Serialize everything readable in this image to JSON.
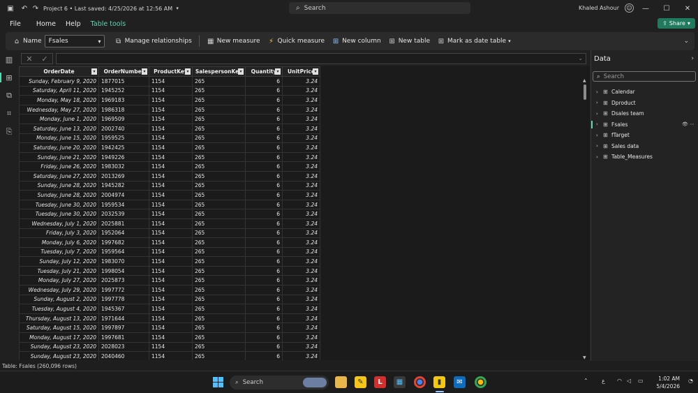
{
  "titlebar": {
    "title": "Project 6 • Last saved: 4/25/2026 at 12:56 AM",
    "search_placeholder": "Search",
    "user_name": "Khaled Ashour"
  },
  "menu": {
    "file": "File",
    "home": "Home",
    "help": "Help",
    "table_tools": "Table tools",
    "share": "Share"
  },
  "ribbon": {
    "name_label": "Name",
    "name_value": "Fsales",
    "manage_relationships": "Manage relationships",
    "new_measure": "New measure",
    "quick_measure": "Quick measure",
    "new_column": "New column",
    "new_table": "New table",
    "mark_as_date_table": "Mark as date table"
  },
  "table": {
    "headers": [
      "OrderDate",
      "OrderNumber",
      "ProductKey",
      "SalespersonKey",
      "Quantity",
      "UnitPrice"
    ],
    "rows": [
      [
        "Sunday, February 9, 2020",
        "1877015",
        "1154",
        "265",
        "6",
        "3.24"
      ],
      [
        "Saturday, April 11, 2020",
        "1945252",
        "1154",
        "265",
        "6",
        "3.24"
      ],
      [
        "Monday, May 18, 2020",
        "1969183",
        "1154",
        "265",
        "6",
        "3.24"
      ],
      [
        "Wednesday, May 27, 2020",
        "1986318",
        "1154",
        "265",
        "6",
        "3.24"
      ],
      [
        "Monday, June 1, 2020",
        "1969509",
        "1154",
        "265",
        "6",
        "3.24"
      ],
      [
        "Saturday, June 13, 2020",
        "2002740",
        "1154",
        "265",
        "6",
        "3.24"
      ],
      [
        "Monday, June 15, 2020",
        "1959525",
        "1154",
        "265",
        "6",
        "3.24"
      ],
      [
        "Saturday, June 20, 2020",
        "1942425",
        "1154",
        "265",
        "6",
        "3.24"
      ],
      [
        "Sunday, June 21, 2020",
        "1949226",
        "1154",
        "265",
        "6",
        "3.24"
      ],
      [
        "Friday, June 26, 2020",
        "1983032",
        "1154",
        "265",
        "6",
        "3.24"
      ],
      [
        "Saturday, June 27, 2020",
        "2013269",
        "1154",
        "265",
        "6",
        "3.24"
      ],
      [
        "Sunday, June 28, 2020",
        "1945282",
        "1154",
        "265",
        "6",
        "3.24"
      ],
      [
        "Sunday, June 28, 2020",
        "2004974",
        "1154",
        "265",
        "6",
        "3.24"
      ],
      [
        "Tuesday, June 30, 2020",
        "1959534",
        "1154",
        "265",
        "6",
        "3.24"
      ],
      [
        "Tuesday, June 30, 2020",
        "2032539",
        "1154",
        "265",
        "6",
        "3.24"
      ],
      [
        "Wednesday, July 1, 2020",
        "2025881",
        "1154",
        "265",
        "6",
        "3.24"
      ],
      [
        "Friday, July 3, 2020",
        "1952064",
        "1154",
        "265",
        "6",
        "3.24"
      ],
      [
        "Monday, July 6, 2020",
        "1997682",
        "1154",
        "265",
        "6",
        "3.24"
      ],
      [
        "Tuesday, July 7, 2020",
        "1959564",
        "1154",
        "265",
        "6",
        "3.24"
      ],
      [
        "Sunday, July 12, 2020",
        "1983070",
        "1154",
        "265",
        "6",
        "3.24"
      ],
      [
        "Tuesday, July 21, 2020",
        "1998054",
        "1154",
        "265",
        "6",
        "3.24"
      ],
      [
        "Monday, July 27, 2020",
        "2025873",
        "1154",
        "265",
        "6",
        "3.24"
      ],
      [
        "Wednesday, July 29, 2020",
        "1997772",
        "1154",
        "265",
        "6",
        "3.24"
      ],
      [
        "Sunday, August 2, 2020",
        "1997778",
        "1154",
        "265",
        "6",
        "3.24"
      ],
      [
        "Tuesday, August 4, 2020",
        "1945367",
        "1154",
        "265",
        "6",
        "3.24"
      ],
      [
        "Thursday, August 13, 2020",
        "1971644",
        "1154",
        "265",
        "6",
        "3.24"
      ],
      [
        "Saturday, August 15, 2020",
        "1997897",
        "1154",
        "265",
        "6",
        "3.24"
      ],
      [
        "Monday, August 17, 2020",
        "1997681",
        "1154",
        "265",
        "6",
        "3.24"
      ],
      [
        "Sunday, August 23, 2020",
        "2028023",
        "1154",
        "265",
        "6",
        "3.24"
      ],
      [
        "Sunday, August 23, 2020",
        "2040460",
        "1154",
        "265",
        "6",
        "3.24"
      ]
    ]
  },
  "data_pane": {
    "title": "Data",
    "search_placeholder": "Search",
    "tables": [
      {
        "label": "Calendar",
        "active": false
      },
      {
        "label": "Dproduct",
        "active": false
      },
      {
        "label": "Dsales team",
        "active": false
      },
      {
        "label": "Fsales",
        "active": true
      },
      {
        "label": "fTarget",
        "active": false
      },
      {
        "label": "Sales data",
        "active": false
      },
      {
        "label": "Table_Measures",
        "active": false
      }
    ]
  },
  "statusbar": {
    "text": "Table: Fsales (260,096 rows)"
  },
  "taskbar": {
    "search": "Search",
    "keyboard_lang": "ع",
    "time": "1:02 AM",
    "date": "5/4/2026"
  },
  "colors": {
    "accent": "#5dd6b6",
    "share_button": "#1f7a5e",
    "background": "#202020"
  }
}
